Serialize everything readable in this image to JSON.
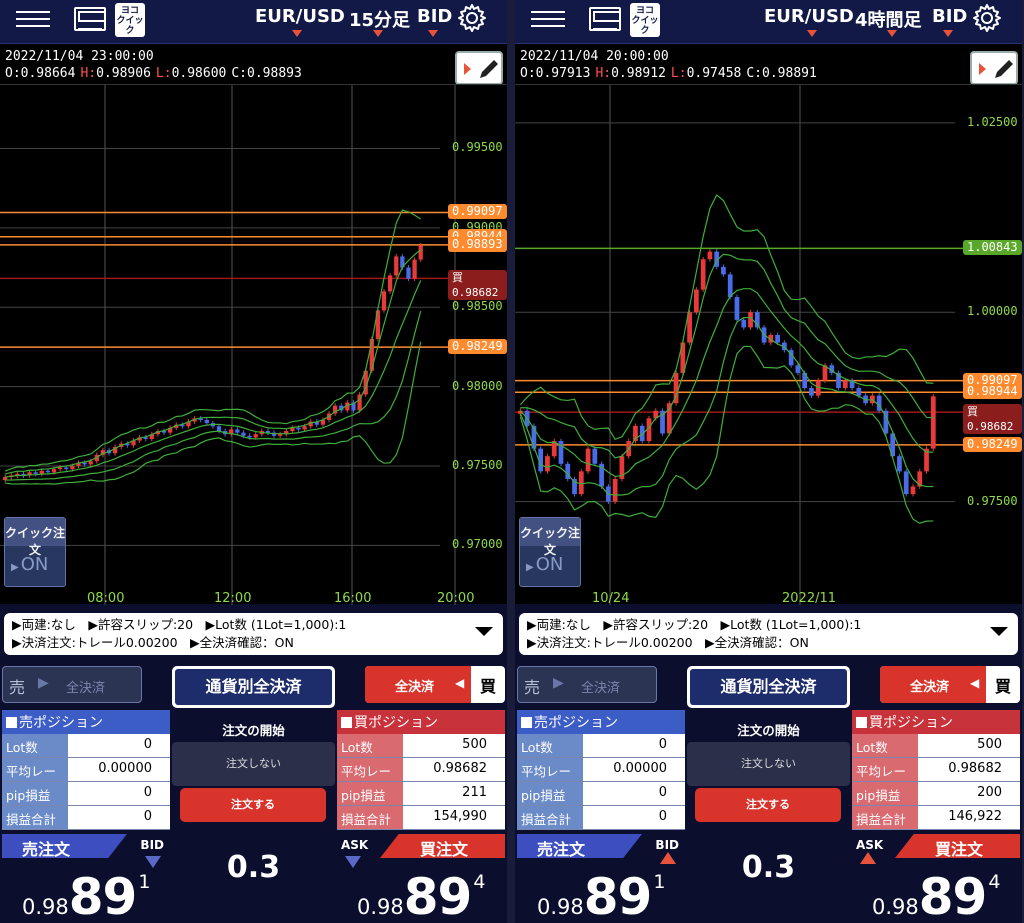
{
  "common": {
    "yoko_quick": "ヨコ\nクイック",
    "quick_order_label": "クイック注文",
    "quick_order_state": "ON",
    "options_line1": "▶両建:なし　▶許容スリップ:20　▶Lot数 (1Lot=1,000):1",
    "options_line2": "▶決済注文:トレール0.00200　▶全決済確認：ON",
    "sell_label": "売",
    "settle_all": "全決済",
    "currency_settle_all": "通貨別全決済",
    "buy_label": "買",
    "sell_positions_title": "売ポジション",
    "buy_positions_title": "買ポジション",
    "row_labels": [
      "Lot数",
      "平均レート",
      "pip損益",
      "損益合計"
    ],
    "order_start": "注文の開始",
    "no_order": "注文しない",
    "do_order": "注文する",
    "spread": "0.3",
    "sell_order": "売注文",
    "buy_order": "買注文",
    "bid": "BID",
    "ask": "ASK",
    "colors": {
      "accent_red": "#d8342c",
      "accent_blue": "#3c4ec0",
      "axis_green": "#8fd94a",
      "line_orange": "#ff8b2e"
    }
  },
  "panels": [
    {
      "pair": "EUR/USD",
      "timeframe": "15分足",
      "price_type": "BID",
      "datetime": "2022/11/04 23:00:00",
      "ohlc": [
        {
          "k": "O:",
          "v": "0.98664"
        },
        {
          "k": "H:",
          "v": "0.98906"
        },
        {
          "k": "L:",
          "v": "0.98600"
        },
        {
          "k": "C:",
          "v": "0.98893"
        }
      ],
      "chart_data": {
        "type": "candlestick",
        "y_axis_ticks": [
          "0.99500",
          "0.99000",
          "0.98500",
          "0.98000",
          "0.97500",
          "0.97000"
        ],
        "y_range": [
          0.9675,
          0.999
        ],
        "x_axis_ticks": [
          "08:00",
          "12:00",
          "16:00",
          "20:00"
        ],
        "price_lines": [
          {
            "label": "0.99097",
            "value": 0.99097,
            "kind": "orange"
          },
          {
            "label": "0.98944",
            "value": 0.98944,
            "kind": "orange"
          },
          {
            "label": "0.98893",
            "value": 0.98893,
            "kind": "orange"
          },
          {
            "label": "買 0.98682",
            "value": 0.98682,
            "kind": "red"
          },
          {
            "label": "0.98249",
            "value": 0.98249,
            "kind": "orange"
          }
        ],
        "closes": [
          0.9743,
          0.9744,
          0.9745,
          0.9744,
          0.9746,
          0.9745,
          0.9747,
          0.9746,
          0.9748,
          0.9749,
          0.9748,
          0.975,
          0.9752,
          0.9751,
          0.9753,
          0.9757,
          0.976,
          0.9758,
          0.9762,
          0.9764,
          0.9763,
          0.9766,
          0.9768,
          0.9767,
          0.977,
          0.9772,
          0.9771,
          0.9774,
          0.9776,
          0.9775,
          0.9778,
          0.978,
          0.9779,
          0.9777,
          0.9775,
          0.9772,
          0.977,
          0.9773,
          0.9771,
          0.9769,
          0.9768,
          0.977,
          0.9772,
          0.9771,
          0.9769,
          0.977,
          0.9772,
          0.9774,
          0.9773,
          0.9775,
          0.9778,
          0.9776,
          0.9779,
          0.9783,
          0.9788,
          0.9785,
          0.979,
          0.9785,
          0.9795,
          0.981,
          0.983,
          0.9848,
          0.986,
          0.987,
          0.9882,
          0.9875,
          0.9868,
          0.988,
          0.9889
        ]
      },
      "sell_values": [
        "0",
        "0.00000",
        "0",
        "0"
      ],
      "buy_values": [
        "500",
        "0.98682",
        "211",
        "154,990"
      ],
      "bid_pre": "0.98",
      "bid_big": "89",
      "bid_sup": "1",
      "ask_pre": "0.98",
      "ask_big": "89",
      "ask_sup": "4",
      "bid_dir": "down",
      "ask_dir": "down"
    },
    {
      "pair": "EUR/USD",
      "timeframe": "4時間足",
      "price_type": "BID",
      "datetime": "2022/11/04 20:00:00",
      "ohlc": [
        {
          "k": "O:",
          "v": "0.97913"
        },
        {
          "k": "H:",
          "v": "0.98912"
        },
        {
          "k": "L:",
          "v": "0.97458"
        },
        {
          "k": "C:",
          "v": "0.98891"
        }
      ],
      "chart_data": {
        "type": "candlestick",
        "y_axis_ticks": [
          "1.02500",
          "1.00843",
          "1.00000",
          "0.97500"
        ],
        "y_range": [
          0.964,
          1.03
        ],
        "x_axis_ticks": [
          "10/24",
          "2022/11"
        ],
        "price_lines": [
          {
            "label": "1.00843",
            "value": 1.00843,
            "kind": "gbox"
          },
          {
            "label": "0.99097",
            "value": 0.99097,
            "kind": "orange"
          },
          {
            "label": "0.98944",
            "value": 0.98944,
            "kind": "orange"
          },
          {
            "label": "買 0.98682",
            "value": 0.98682,
            "kind": "red"
          },
          {
            "label": "0.98249",
            "value": 0.98249,
            "kind": "orange"
          }
        ],
        "closes": [
          0.987,
          0.985,
          0.982,
          0.979,
          0.981,
          0.983,
          0.98,
          0.978,
          0.976,
          0.979,
          0.982,
          0.98,
          0.977,
          0.975,
          0.978,
          0.981,
          0.983,
          0.985,
          0.983,
          0.986,
          0.987,
          0.984,
          0.988,
          0.992,
          0.996,
          1.0,
          1.003,
          1.007,
          1.008,
          1.006,
          1.005,
          1.002,
          0.999,
          0.998,
          1.0,
          0.998,
          0.996,
          0.997,
          0.996,
          0.995,
          0.993,
          0.992,
          0.99,
          0.989,
          0.991,
          0.993,
          0.992,
          0.99,
          0.991,
          0.99,
          0.989,
          0.988,
          0.989,
          0.987,
          0.984,
          0.981,
          0.979,
          0.976,
          0.977,
          0.979,
          0.982,
          0.9889
        ]
      },
      "sell_values": [
        "0",
        "0.00000",
        "0",
        "0"
      ],
      "buy_values": [
        "500",
        "0.98682",
        "200",
        "146,922"
      ],
      "bid_pre": "0.98",
      "bid_big": "89",
      "bid_sup": "1",
      "ask_pre": "0.98",
      "ask_big": "89",
      "ask_sup": "4",
      "bid_dir": "up",
      "ask_dir": "up"
    }
  ]
}
